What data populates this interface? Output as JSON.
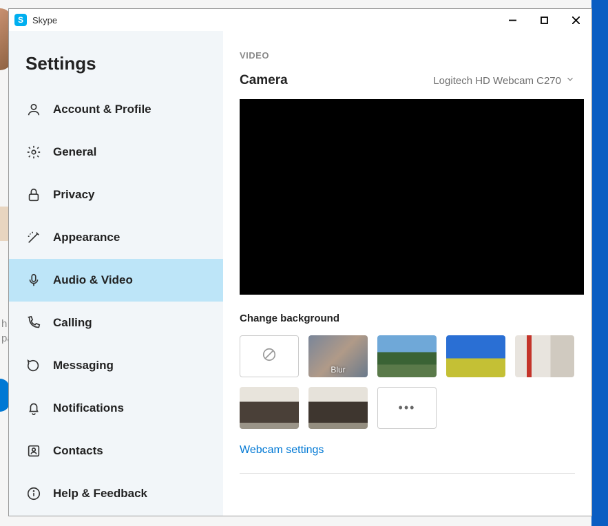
{
  "app": {
    "title": "Skype"
  },
  "sidebar": {
    "title": "Settings",
    "items": [
      {
        "label": "Account & Profile"
      },
      {
        "label": "General"
      },
      {
        "label": "Privacy"
      },
      {
        "label": "Appearance"
      },
      {
        "label": "Audio & Video"
      },
      {
        "label": "Calling"
      },
      {
        "label": "Messaging"
      },
      {
        "label": "Notifications"
      },
      {
        "label": "Contacts"
      },
      {
        "label": "Help & Feedback"
      }
    ]
  },
  "content": {
    "section_label": "VIDEO",
    "camera_label": "Camera",
    "camera_selected": "Logitech HD Webcam C270",
    "change_bg_title": "Change background",
    "bg_options": {
      "blur_label": "Blur"
    },
    "webcam_link": "Webcam settings"
  }
}
